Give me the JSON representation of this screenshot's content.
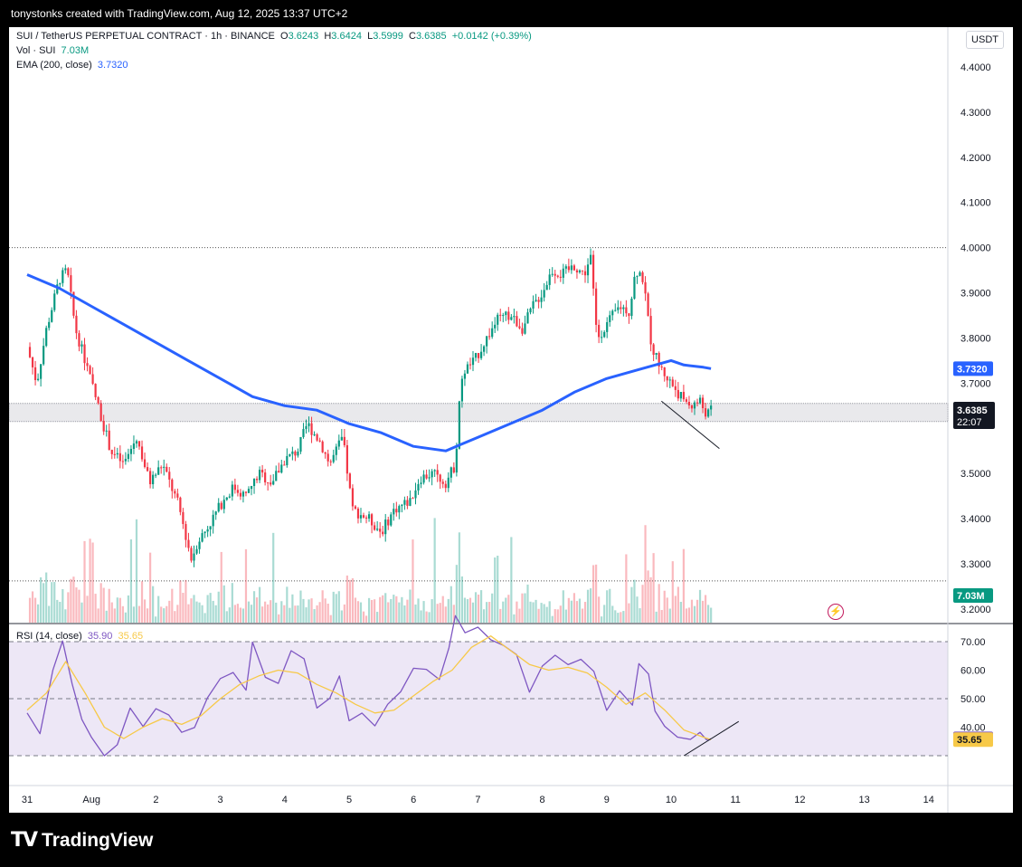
{
  "header": {
    "attribution": "tonystonks created with TradingView.com, Aug 12, 2025 13:37 UTC+2"
  },
  "legend": {
    "symbol": "SUI / TetherUS PERPETUAL CONTRACT · 1h · BINANCE",
    "o_label": "O",
    "o": "3.6243",
    "h_label": "H",
    "h": "3.6424",
    "l_label": "L",
    "l": "3.5999",
    "c_label": "C",
    "c": "3.6385",
    "change": "+0.0142 (+0.39%)",
    "vol_label": "Vol · SUI",
    "vol": "7.03M",
    "ema_label": "EMA (200, close)",
    "ema": "3.7320",
    "rsi_label": "RSI (14, close)",
    "rsi": "35.90",
    "rsi_ma": "35.65"
  },
  "currency_button": "USDT",
  "price_axis": {
    "ticks": [
      "4.4000",
      "4.3000",
      "4.2000",
      "4.1000",
      "4.0000",
      "3.9000",
      "3.8000",
      "3.7000",
      "3.5000",
      "3.4000",
      "3.3000",
      "3.2000"
    ],
    "ema_badge": "3.7320",
    "price_badge": "3.6385",
    "countdown": "22:07",
    "vol_badge": "7.03M"
  },
  "rsi_axis": {
    "ticks": [
      "70.00",
      "60.00",
      "50.00",
      "40.00"
    ],
    "rsi_badge": "35.90",
    "rsi_ma_badge": "35.65"
  },
  "time_axis": [
    "31",
    "Aug",
    "2",
    "3",
    "4",
    "5",
    "6",
    "7",
    "8",
    "9",
    "10",
    "11",
    "12",
    "13",
    "14"
  ],
  "footer": {
    "logo_text": "TradingView"
  },
  "colors": {
    "up": "#089981",
    "down": "#f23645",
    "ema": "#2962ff",
    "rsi": "#7e57c2",
    "rsi_ma": "#f7c948",
    "rsi_band": "#ede7f6"
  },
  "chart_data": {
    "type": "candlestick",
    "title": "SUI / TetherUS PERPETUAL CONTRACT · 1h · BINANCE",
    "ylim": [
      3.2,
      4.45
    ],
    "x_days": [
      "31",
      "Aug",
      "2",
      "3",
      "4",
      "5",
      "6",
      "7",
      "8",
      "9",
      "10",
      "11",
      "12",
      "13",
      "14"
    ],
    "price_path": [
      [
        0,
        3.78
      ],
      [
        0.15,
        3.7
      ],
      [
        0.3,
        3.82
      ],
      [
        0.5,
        3.93
      ],
      [
        0.62,
        3.95
      ],
      [
        0.75,
        3.82
      ],
      [
        0.9,
        3.75
      ],
      [
        1.1,
        3.65
      ],
      [
        1.3,
        3.55
      ],
      [
        1.5,
        3.52
      ],
      [
        1.7,
        3.58
      ],
      [
        1.9,
        3.48
      ],
      [
        2.1,
        3.52
      ],
      [
        2.35,
        3.43
      ],
      [
        2.55,
        3.31
      ],
      [
        2.65,
        3.35
      ],
      [
        2.8,
        3.38
      ],
      [
        3.0,
        3.43
      ],
      [
        3.2,
        3.47
      ],
      [
        3.4,
        3.45
      ],
      [
        3.6,
        3.5
      ],
      [
        3.8,
        3.48
      ],
      [
        4.0,
        3.53
      ],
      [
        4.2,
        3.55
      ],
      [
        4.35,
        3.61
      ],
      [
        4.55,
        3.57
      ],
      [
        4.7,
        3.52
      ],
      [
        4.9,
        3.58
      ],
      [
        5.05,
        3.42
      ],
      [
        5.3,
        3.4
      ],
      [
        5.5,
        3.37
      ],
      [
        5.7,
        3.42
      ],
      [
        5.95,
        3.44
      ],
      [
        6.1,
        3.49
      ],
      [
        6.3,
        3.5
      ],
      [
        6.5,
        3.48
      ],
      [
        6.65,
        3.52
      ],
      [
        6.72,
        3.68
      ],
      [
        6.8,
        3.73
      ],
      [
        6.95,
        3.75
      ],
      [
        7.1,
        3.79
      ],
      [
        7.3,
        3.84
      ],
      [
        7.5,
        3.85
      ],
      [
        7.7,
        3.82
      ],
      [
        7.85,
        3.87
      ],
      [
        8.0,
        3.9
      ],
      [
        8.15,
        3.95
      ],
      [
        8.3,
        3.94
      ],
      [
        8.5,
        3.96
      ],
      [
        8.65,
        3.94
      ],
      [
        8.75,
        3.98
      ],
      [
        8.85,
        3.8
      ],
      [
        9.0,
        3.83
      ],
      [
        9.2,
        3.87
      ],
      [
        9.35,
        3.86
      ],
      [
        9.45,
        3.95
      ],
      [
        9.55,
        3.94
      ],
      [
        9.7,
        3.78
      ],
      [
        9.85,
        3.73
      ],
      [
        10.0,
        3.7
      ],
      [
        10.15,
        3.67
      ],
      [
        10.3,
        3.65
      ],
      [
        10.45,
        3.66
      ],
      [
        10.55,
        3.63
      ],
      [
        10.62,
        3.64
      ]
    ],
    "ema_200": [
      [
        0,
        3.94
      ],
      [
        0.5,
        3.91
      ],
      [
        1.0,
        3.87
      ],
      [
        1.5,
        3.83
      ],
      [
        2.0,
        3.79
      ],
      [
        2.5,
        3.75
      ],
      [
        3.0,
        3.71
      ],
      [
        3.5,
        3.67
      ],
      [
        4.0,
        3.65
      ],
      [
        4.5,
        3.64
      ],
      [
        5.0,
        3.61
      ],
      [
        5.5,
        3.59
      ],
      [
        6.0,
        3.56
      ],
      [
        6.5,
        3.55
      ],
      [
        7.0,
        3.58
      ],
      [
        7.5,
        3.61
      ],
      [
        8.0,
        3.64
      ],
      [
        8.5,
        3.68
      ],
      [
        9.0,
        3.71
      ],
      [
        9.5,
        3.73
      ],
      [
        10.0,
        3.75
      ],
      [
        10.2,
        3.74
      ],
      [
        10.5,
        3.735
      ],
      [
        10.62,
        3.732
      ]
    ],
    "horizontal_levels": [
      4.0,
      3.262
    ],
    "support_zone": [
      3.615,
      3.655
    ],
    "trendline_price": [
      [
        9.85,
        3.66
      ],
      [
        10.75,
        3.555
      ]
    ],
    "rsi": [
      [
        0,
        45
      ],
      [
        0.2,
        38
      ],
      [
        0.4,
        60
      ],
      [
        0.55,
        70
      ],
      [
        0.7,
        55
      ],
      [
        0.85,
        42
      ],
      [
        1.0,
        36
      ],
      [
        1.2,
        30
      ],
      [
        1.4,
        34
      ],
      [
        1.6,
        46
      ],
      [
        1.8,
        40
      ],
      [
        2.0,
        46
      ],
      [
        2.2,
        44
      ],
      [
        2.4,
        38
      ],
      [
        2.6,
        40
      ],
      [
        2.8,
        50
      ],
      [
        3.0,
        58
      ],
      [
        3.2,
        60
      ],
      [
        3.4,
        53
      ],
      [
        3.5,
        70
      ],
      [
        3.7,
        58
      ],
      [
        3.9,
        55
      ],
      [
        4.1,
        67
      ],
      [
        4.3,
        64
      ],
      [
        4.5,
        46
      ],
      [
        4.7,
        50
      ],
      [
        4.85,
        58
      ],
      [
        5.0,
        42
      ],
      [
        5.2,
        45
      ],
      [
        5.4,
        40
      ],
      [
        5.6,
        48
      ],
      [
        5.8,
        52
      ],
      [
        6.0,
        60
      ],
      [
        6.2,
        61
      ],
      [
        6.4,
        56
      ],
      [
        6.55,
        68
      ],
      [
        6.65,
        80
      ],
      [
        6.8,
        73
      ],
      [
        7.0,
        76
      ],
      [
        7.2,
        70
      ],
      [
        7.4,
        69
      ],
      [
        7.6,
        66
      ],
      [
        7.8,
        53
      ],
      [
        8.0,
        61
      ],
      [
        8.2,
        65
      ],
      [
        8.4,
        62
      ],
      [
        8.6,
        64
      ],
      [
        8.8,
        59
      ],
      [
        9.0,
        46
      ],
      [
        9.2,
        52
      ],
      [
        9.4,
        48
      ],
      [
        9.5,
        62
      ],
      [
        9.65,
        58
      ],
      [
        9.75,
        45
      ],
      [
        9.9,
        40
      ],
      [
        10.1,
        36
      ],
      [
        10.3,
        35
      ],
      [
        10.45,
        39
      ],
      [
        10.55,
        36
      ],
      [
        10.62,
        35.9
      ]
    ],
    "rsi_ma": [
      [
        0,
        46
      ],
      [
        0.3,
        52
      ],
      [
        0.6,
        63
      ],
      [
        0.9,
        52
      ],
      [
        1.2,
        40
      ],
      [
        1.5,
        36
      ],
      [
        1.8,
        40
      ],
      [
        2.1,
        43
      ],
      [
        2.4,
        41
      ],
      [
        2.7,
        44
      ],
      [
        3.0,
        50
      ],
      [
        3.3,
        55
      ],
      [
        3.6,
        58
      ],
      [
        3.9,
        60
      ],
      [
        4.2,
        59
      ],
      [
        4.5,
        55
      ],
      [
        4.8,
        52
      ],
      [
        5.1,
        48
      ],
      [
        5.4,
        45
      ],
      [
        5.7,
        46
      ],
      [
        6.0,
        51
      ],
      [
        6.3,
        56
      ],
      [
        6.6,
        60
      ],
      [
        6.9,
        68
      ],
      [
        7.2,
        72
      ],
      [
        7.5,
        67
      ],
      [
        7.8,
        62
      ],
      [
        8.1,
        60
      ],
      [
        8.4,
        61
      ],
      [
        8.7,
        59
      ],
      [
        9.0,
        54
      ],
      [
        9.3,
        48
      ],
      [
        9.6,
        52
      ],
      [
        9.9,
        46
      ],
      [
        10.2,
        39
      ],
      [
        10.5,
        36.5
      ],
      [
        10.62,
        35.65
      ]
    ],
    "rsi_levels": [
      70,
      50,
      30
    ],
    "rsi_ylim": [
      20,
      80
    ],
    "trendline_rsi": [
      [
        10.2,
        30
      ],
      [
        11.05,
        42
      ]
    ]
  }
}
